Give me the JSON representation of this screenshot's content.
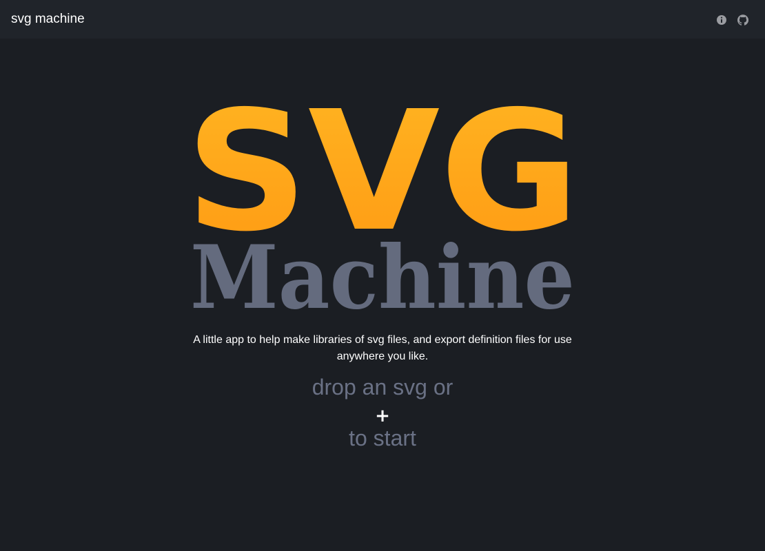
{
  "header": {
    "title": "svg machine",
    "icons": [
      "info-icon",
      "github-icon"
    ]
  },
  "logo": {
    "line1": "SVG",
    "line2": "Machine",
    "gradient_top": "#ffb522",
    "gradient_bottom": "#ff9a13",
    "line2_color": "#646b7e"
  },
  "main": {
    "tagline": "A little app to help make libraries of svg files, and export definition files for use anywhere you like.",
    "drop_text": "drop an svg or",
    "add_label": "+",
    "start_text": "to start"
  },
  "colors": {
    "background": "#1b1e23",
    "header_bg": "#20242a",
    "muted_text": "#6a7185",
    "icon_color": "#9a9ca1"
  }
}
